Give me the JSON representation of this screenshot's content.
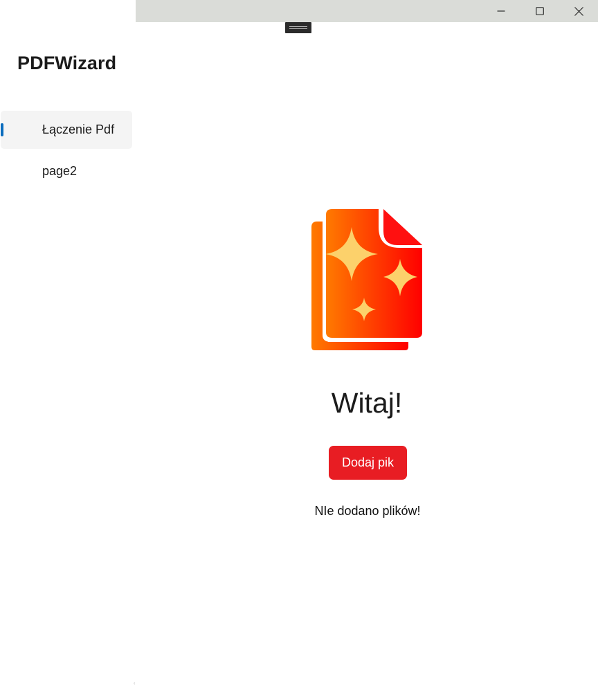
{
  "app": {
    "title": "PDFWizard"
  },
  "window_controls": {
    "minimize_icon": "minimize-icon",
    "maximize_icon": "maximize-icon",
    "close_icon": "close-icon"
  },
  "sidebar": {
    "items": [
      {
        "label": "Łączenie Pdf",
        "selected": true
      },
      {
        "label": "page2",
        "selected": false
      }
    ],
    "indicator_color": "#0a6cbd"
  },
  "main": {
    "logo_icon": "pdf-wizard-logo-icon",
    "welcome": "Witaj!",
    "add_button_label": "Dodaj pik",
    "status_text": "NIe dodano plików!"
  },
  "colors": {
    "accent": "#e81d23",
    "titlebar": "#dadcd8",
    "logo_gradient_start": "#ff7a00",
    "logo_gradient_end": "#ff0000",
    "sparkle": "#fcd16b"
  }
}
